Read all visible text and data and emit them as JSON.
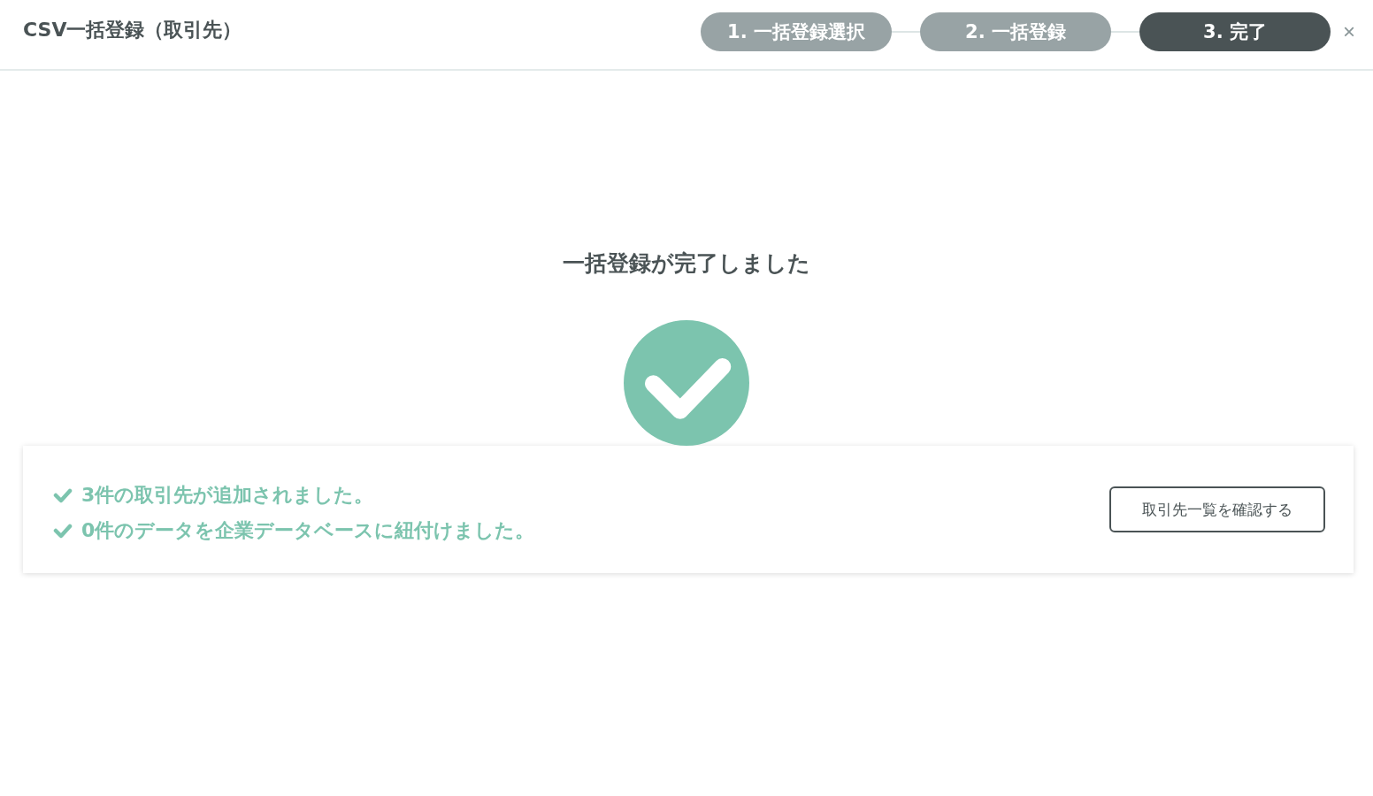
{
  "window": {
    "title": "CSV一括登録（取引先）",
    "close": "×"
  },
  "steps": [
    {
      "label": "1. 一括登録選択",
      "selected": false
    },
    {
      "label": "2. 一括登録",
      "selected": false
    },
    {
      "label": "3. 完了",
      "selected": true
    }
  ],
  "completion": {
    "heading": "一括登録が完了しました"
  },
  "result": {
    "messages": [
      "3件の取引先が追加されました。",
      "0件のデータを企業データベースに紐付けました。"
    ],
    "button": "取引先一覧を確認する"
  }
}
